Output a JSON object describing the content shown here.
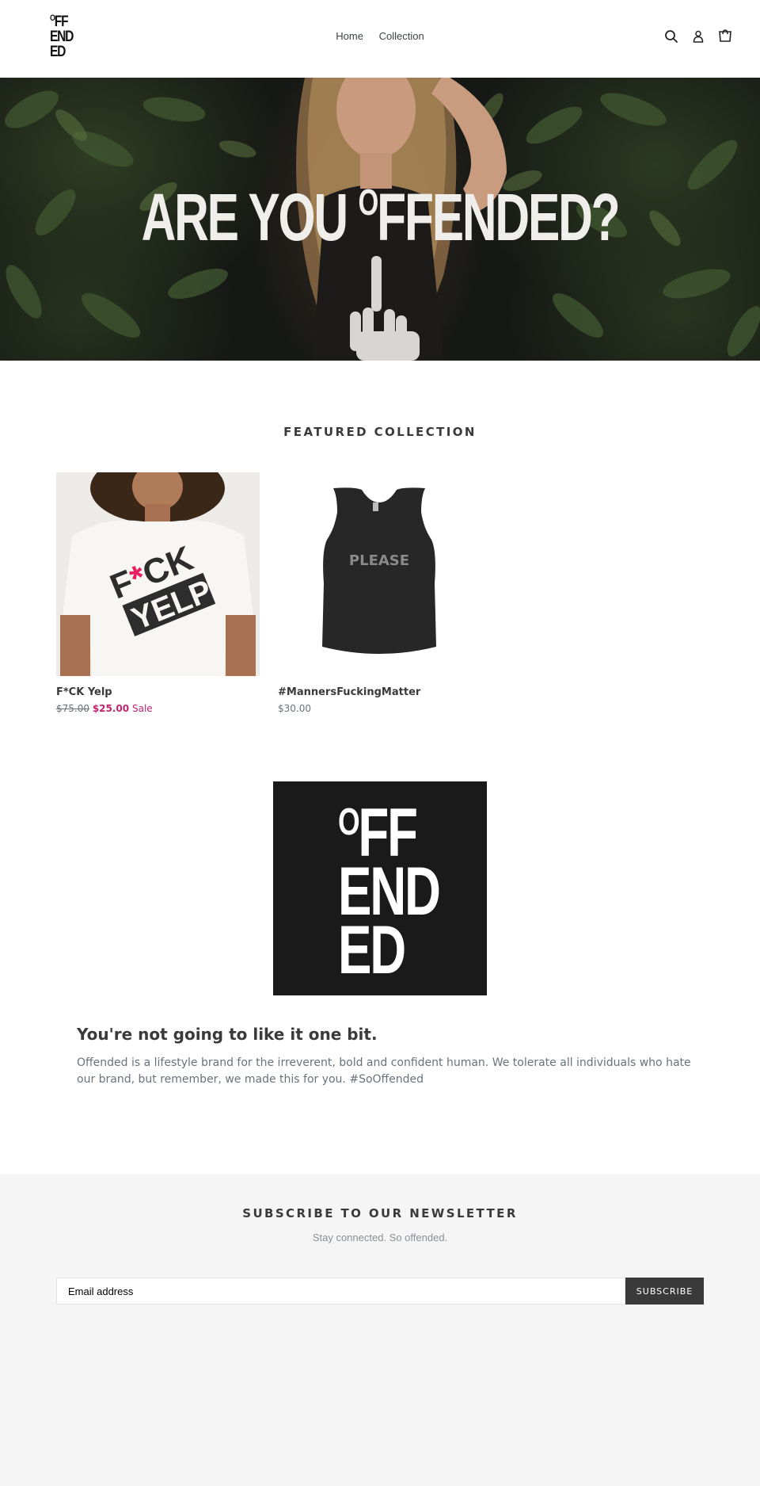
{
  "header": {
    "logo_lines": [
      "FF",
      "END",
      "ED"
    ],
    "logo_super": "O",
    "nav": [
      {
        "label": "Home"
      },
      {
        "label": "Collection"
      }
    ],
    "icons": [
      "search-icon",
      "account-icon",
      "cart-icon"
    ]
  },
  "hero": {
    "title_part1": "ARE YOU ",
    "title_super": "O",
    "title_part2": "FFENDED?"
  },
  "featured": {
    "heading": "FEATURED COLLECTION",
    "products": [
      {
        "title": "F*CK Yelp",
        "compare_price": "$75.00",
        "price": "$25.00",
        "sale_label": "Sale",
        "print_star": "F*CK",
        "print_line2": "YELP"
      },
      {
        "title": "#MannersFuckingMatter",
        "price": "$30.00",
        "print": "PLEASE"
      }
    ]
  },
  "brand": {
    "logo_super": "O",
    "logo_lines": [
      "FF",
      "END",
      "ED"
    ],
    "title": "You're not going to like it one bit.",
    "body": "Offended is a lifestyle brand for the irreverent, bold and confident human. We tolerate all individuals who hate our brand, but remember, we made this for you. #SoOffended"
  },
  "newsletter": {
    "heading": "SUBSCRIBE TO OUR NEWSLETTER",
    "subtext": "Stay connected. So offended.",
    "email_placeholder": "Email address",
    "button_label": "SUBSCRIBE"
  },
  "colors": {
    "accent": "#3a3a3a",
    "sale": "#c0246f",
    "footer_bg": "#f5f5f5",
    "pink_star": "#e91e63"
  }
}
